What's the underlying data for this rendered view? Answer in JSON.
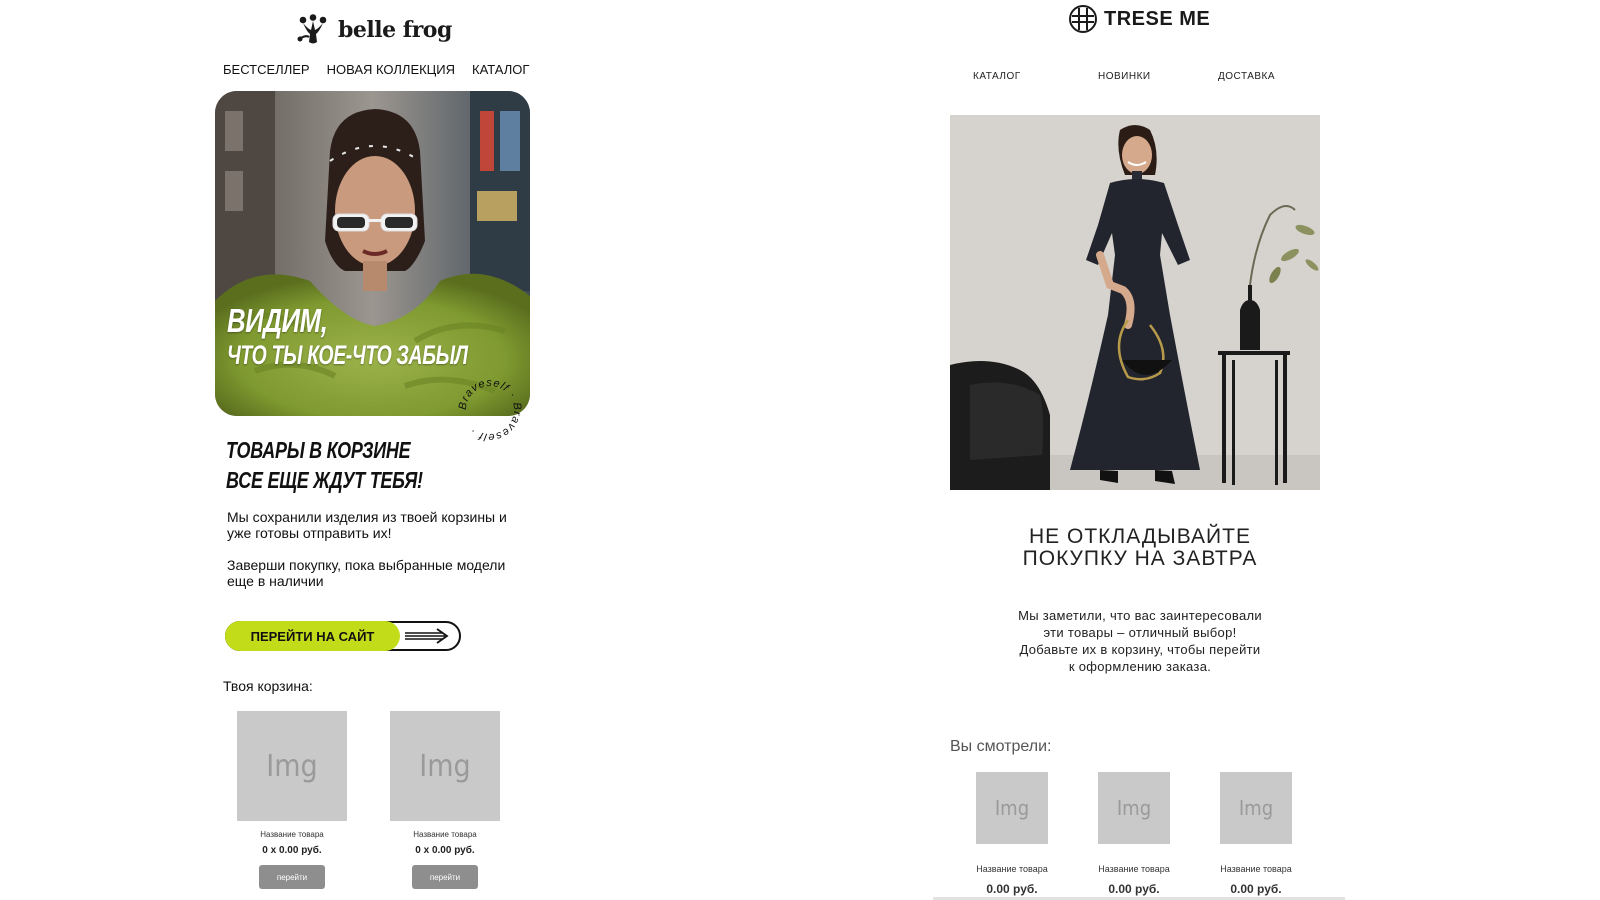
{
  "belle_frog": {
    "logo_text": "belle frog",
    "nav": [
      "БЕСТСЕЛЛЕР",
      "НОВАЯ КОЛЛЕКЦИЯ",
      "КАТАЛОГ"
    ],
    "hero_line1": "ВИДИМ,",
    "hero_line2": "ЧТО ТЫ КОЕ-ЧТО ЗАБЫЛ",
    "seal_text": "Braveself · Braveself ·",
    "heading_line1": "ТОВАРЫ В КОРЗИНЕ",
    "heading_line2": "ВСЕ ЕЩЕ ЖДУТ ТЕБЯ!",
    "paragraph1": "Мы сохранили изделия из твоей корзины и уже готовы отправить их!",
    "paragraph2": "Заверши покупку, пока выбранные модели еще в наличии",
    "cta_label": "ПЕРЕЙТИ НА САЙТ",
    "cart_title": "Твоя корзина:",
    "cart_items": [
      {
        "img": "Img",
        "name": "Название товара",
        "price": "0 x 0.00 руб.",
        "button": "перейти"
      },
      {
        "img": "Img",
        "name": "Название товара",
        "price": "0 x 0.00 руб.",
        "button": "перейти"
      }
    ],
    "accent_color": "#c3dc1a"
  },
  "trese_me": {
    "logo_text": "TRESE ME",
    "nav": [
      "КАТАЛОГ",
      "НОВИНКИ",
      "ДОСТАВКА"
    ],
    "heading_line1": "НЕ ОТКЛАДЫВАЙТЕ",
    "heading_line2": "ПОКУПКУ НА ЗАВТРА",
    "paragraph_lines": [
      "Мы заметили, что вас заинтересовали",
      "эти товары – отличный выбор!",
      "Добавьте их в корзину, чтобы перейти",
      "к оформлению заказа."
    ],
    "viewed_title": "Вы смотрели:",
    "viewed_items": [
      {
        "img": "Img",
        "name": "Название товара",
        "price": "0.00 руб."
      },
      {
        "img": "Img",
        "name": "Название товара",
        "price": "0.00 руб."
      },
      {
        "img": "Img",
        "name": "Название товара",
        "price": "0.00 руб."
      }
    ]
  }
}
